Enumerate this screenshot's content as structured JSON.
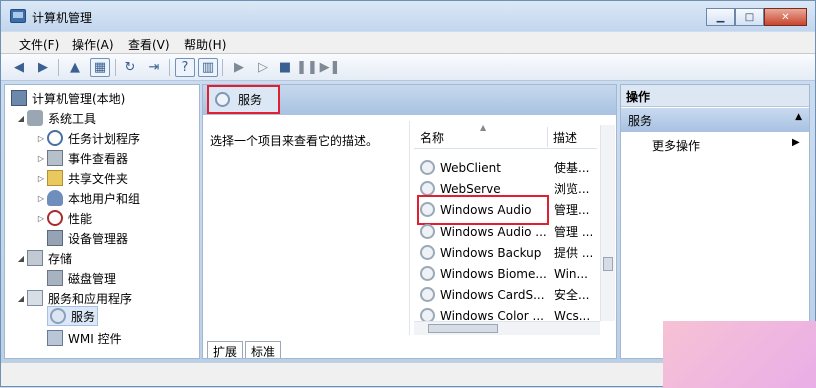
{
  "window": {
    "title": "计算机管理"
  },
  "window_buttons": {
    "minimize": "▁",
    "maximize": "□",
    "close": "✕"
  },
  "menu": {
    "items": [
      "文件(F)",
      "操作(A)",
      "查看(V)",
      "帮助(H)"
    ]
  },
  "toolbar": {
    "back": "◀",
    "forward": "▶",
    "play": "▶",
    "play2": "▷",
    "stop": "■",
    "pause": "❚❚",
    "restart": "▶❚"
  },
  "tree": {
    "root": "计算机管理(本地)",
    "system_tools": "系统工具",
    "task_scheduler": "任务计划程序",
    "event_viewer": "事件查看器",
    "shared_folders": "共享文件夹",
    "local_users": "本地用户和组",
    "performance": "性能",
    "device_manager": "设备管理器",
    "storage": "存储",
    "disk_management": "磁盘管理",
    "services_apps": "服务和应用程序",
    "services": "服务",
    "wmi": "WMI 控件"
  },
  "center": {
    "header": "服务",
    "description_prompt": "选择一个项目来查看它的描述。",
    "columns": {
      "name": "名称",
      "desc": "描述"
    },
    "services": [
      {
        "name": "WebClient",
        "desc": "使基..."
      },
      {
        "name": "WebServe",
        "desc": "浏览..."
      },
      {
        "name": "Windows Audio",
        "desc": "管理..."
      },
      {
        "name": "Windows Audio ...",
        "desc": "管理 ..."
      },
      {
        "name": "Windows Backup",
        "desc": "提供 ..."
      },
      {
        "name": "Windows Biome...",
        "desc": "Win..."
      },
      {
        "name": "Windows CardS...",
        "desc": "安全..."
      },
      {
        "name": "Windows Color ...",
        "desc": "Wcs..."
      }
    ],
    "tabs": [
      "扩展",
      "标准"
    ]
  },
  "actions": {
    "title": "操作",
    "section": "服务",
    "more": "更多操作"
  }
}
